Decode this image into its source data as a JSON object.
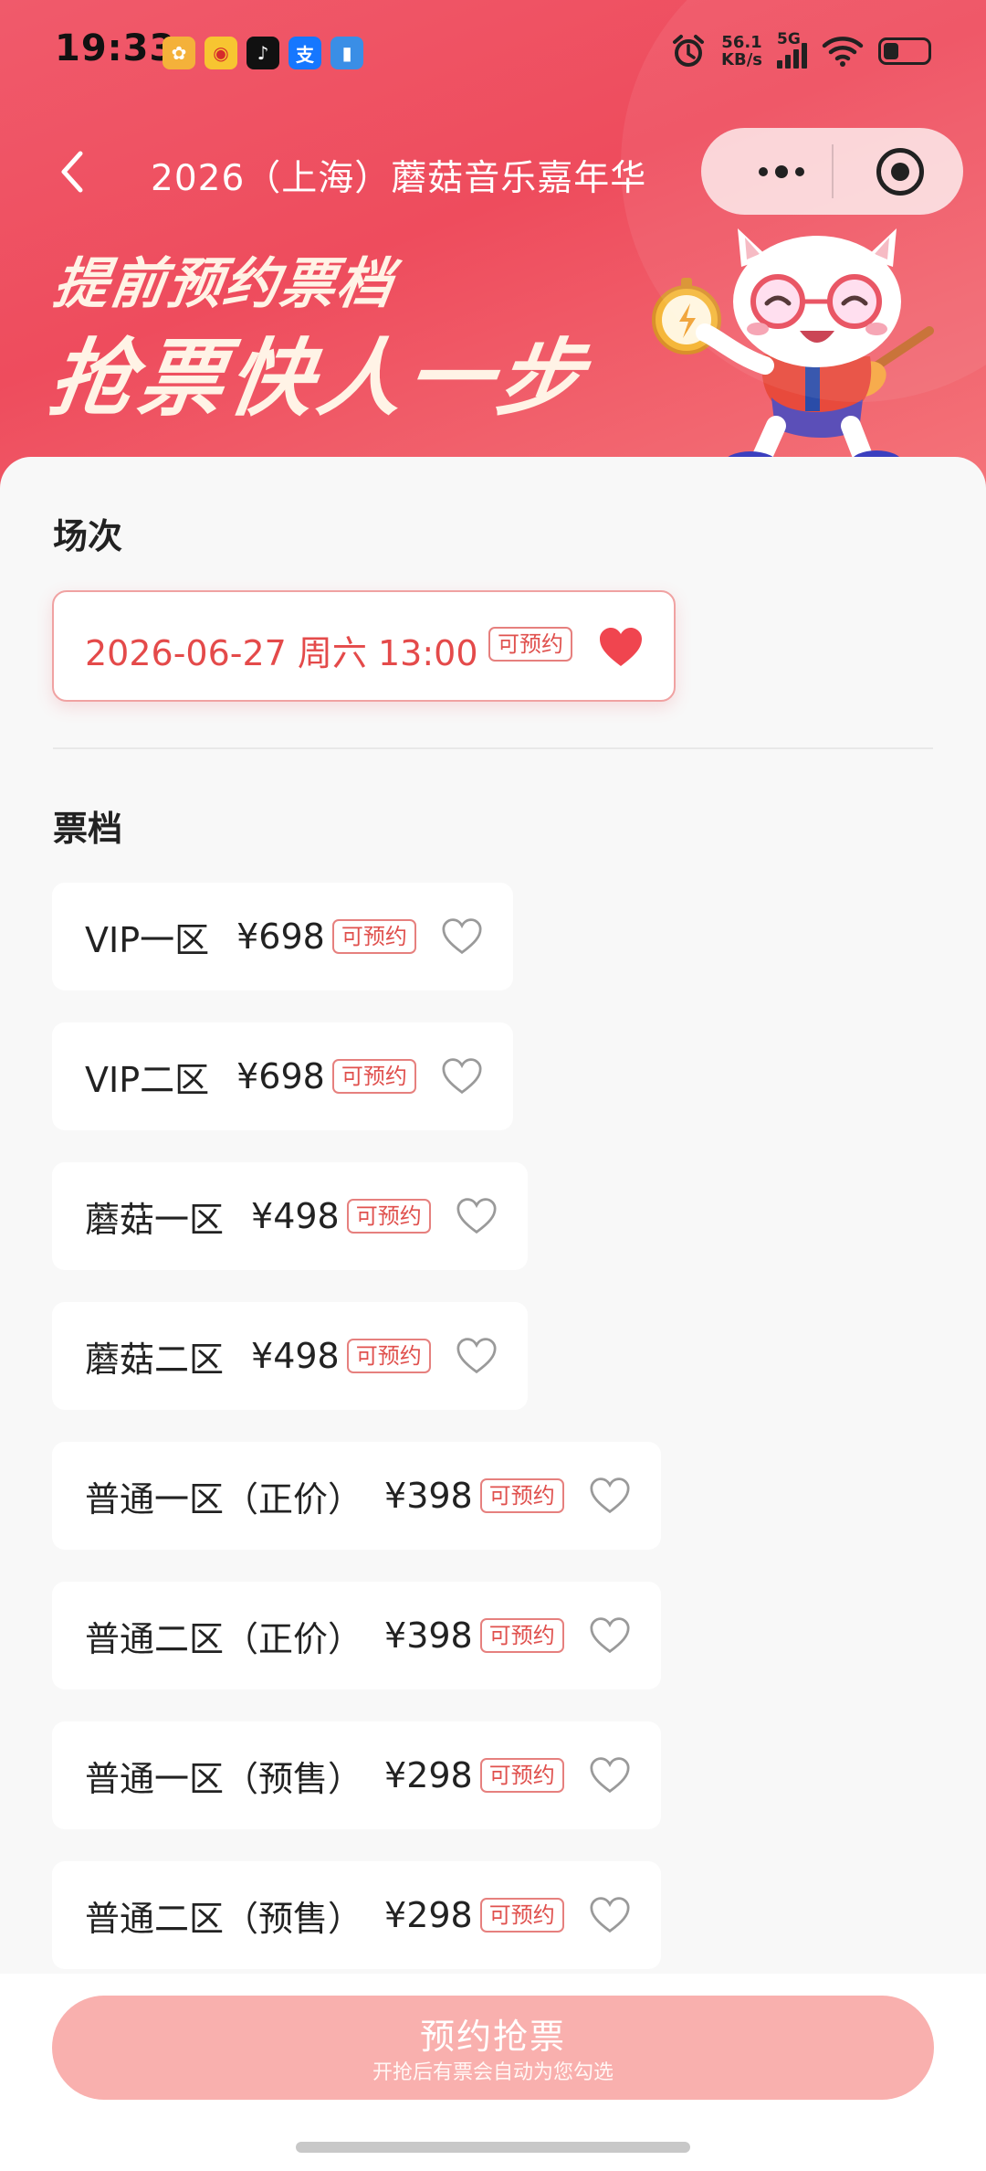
{
  "status_bar": {
    "time": "19:33",
    "net_speed_value": "56.1",
    "net_speed_unit": "KB/s",
    "network_type": "5G",
    "battery_level_fraction": 0.3,
    "app_icons": [
      "photos-app-icon",
      "weibo-app-icon",
      "tiktok-app-icon",
      "alipay-app-icon",
      "files-app-icon"
    ]
  },
  "nav": {
    "title": "2026（上海）蘑菇音乐嘉年华"
  },
  "hero": {
    "slogan_line1": "提前预约票档",
    "slogan_line2": "抢票快人一步",
    "mascot_icon": "cat-mascot-with-stopwatch-and-guitar"
  },
  "session_section": {
    "title": "场次",
    "selected": {
      "label": "2026-06-27 周六 13:00",
      "tag": "可预约",
      "favorited": true
    }
  },
  "tickets_section": {
    "title": "票档",
    "items": [
      {
        "name": "VIP一区",
        "price": "¥698",
        "tag": "可预约",
        "favorited": false
      },
      {
        "name": "VIP二区",
        "price": "¥698",
        "tag": "可预约",
        "favorited": false
      },
      {
        "name": "蘑菇一区",
        "price": "¥498",
        "tag": "可预约",
        "favorited": false
      },
      {
        "name": "蘑菇二区",
        "price": "¥498",
        "tag": "可预约",
        "favorited": false
      },
      {
        "name": "普通一区（正价）",
        "price": "¥398",
        "tag": "可预约",
        "favorited": false
      },
      {
        "name": "普通二区（正价）",
        "price": "¥398",
        "tag": "可预约",
        "favorited": false
      },
      {
        "name": "普通一区（预售）",
        "price": "¥298",
        "tag": "可预约",
        "favorited": false
      },
      {
        "name": "普通二区（预售）",
        "price": "¥298",
        "tag": "可预约",
        "favorited": false
      }
    ]
  },
  "bottom_bar": {
    "button_label": "预约抢票",
    "button_sublabel": "开抢后有票会自动为您勾选"
  },
  "colors": {
    "brand_red": "#ee4c5d",
    "tag_red": "#e0514e",
    "cta_disabled": "#f9b0ae"
  }
}
